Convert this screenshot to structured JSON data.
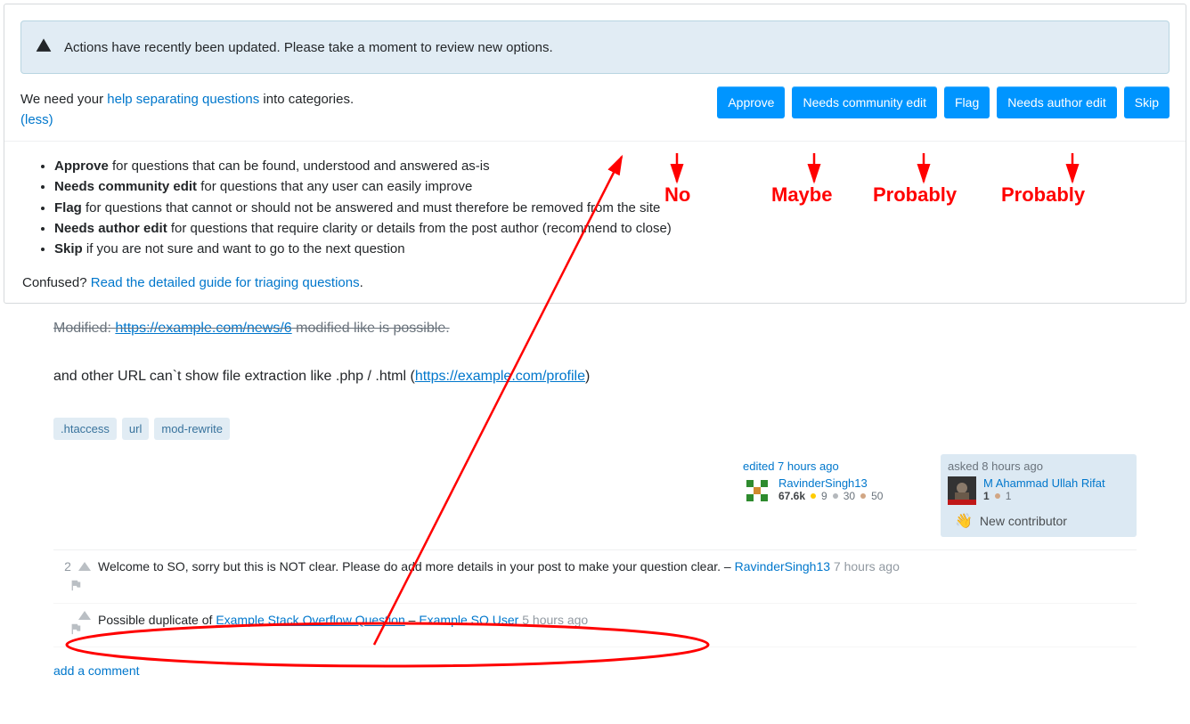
{
  "notice": "Actions have recently been updated. Please take a moment to review new options.",
  "topbar": {
    "prefix": "We need your ",
    "link": "help separating questions",
    "suffix": " into categories.",
    "less": "(less)"
  },
  "buttons": {
    "approve": "Approve",
    "community": "Needs community edit",
    "flag": "Flag",
    "author": "Needs author edit",
    "skip": "Skip"
  },
  "guide": {
    "items": [
      {
        "strong": "Approve",
        "rest": " for questions that can be found, understood and answered as-is"
      },
      {
        "strong": "Needs community edit",
        "rest": " for questions that any user can easily improve"
      },
      {
        "strong": "Flag",
        "rest": " for questions that cannot or should not be answered and must therefore be removed from the site"
      },
      {
        "strong": "Needs author edit",
        "rest": " for questions that require clarity or details from the post author (recommend to close)"
      },
      {
        "strong": "Skip",
        "rest": " if you are not sure and want to go to the next question"
      }
    ],
    "confused_prefix": "Confused? ",
    "confused_link": "Read the detailed guide for triaging questions",
    "confused_suffix": "."
  },
  "post": {
    "truncated_prefix": "Modified: ",
    "truncated_link": "https://example.com/news/6",
    "truncated_suffix": " modified like is possible.",
    "line2_prefix": "and other URL can`t show file extraction like .php / .html (",
    "line2_link": "https://example.com/profile",
    "line2_suffix": ")"
  },
  "tags": [
    ".htaccess",
    "url",
    "mod-rewrite"
  ],
  "editor": {
    "action": "edited 7 hours ago",
    "name": "RavinderSingh13",
    "rep": "67.6k",
    "gold": "9",
    "silver": "30",
    "bronze": "50"
  },
  "asker": {
    "action": "asked 8 hours ago",
    "name": "M Ahammad Ullah Rifat",
    "rep": "1",
    "bronze": "1",
    "new_contributor": "New contributor"
  },
  "comments": [
    {
      "score": "2",
      "text": "Welcome to SO, sorry but this is NOT clear. Please do add more details in your post to make your question clear. – ",
      "author": "RavinderSingh13",
      "time": "7 hours ago"
    },
    {
      "score": "",
      "prefix": "Possible duplicate of ",
      "dupe_link": "Example Stack Overflow Question",
      "sep": " – ",
      "author": "Example SO User",
      "time": "5 hours ago"
    }
  ],
  "add_comment": "add a comment",
  "annotations": {
    "no": "No",
    "maybe": "Maybe",
    "probably1": "Probably",
    "probably2": "Probably"
  }
}
